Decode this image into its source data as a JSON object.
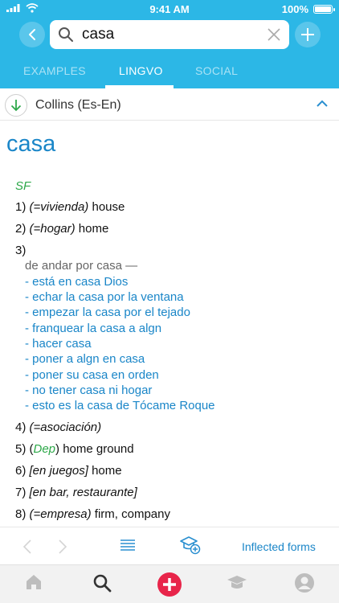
{
  "status": {
    "time": "9:41 AM",
    "battery": "100%"
  },
  "search": {
    "value": "casa"
  },
  "tabs": [
    {
      "label": "EXAMPLES",
      "active": false
    },
    {
      "label": "LINGVO",
      "active": true
    },
    {
      "label": "SOCIAL",
      "active": false
    }
  ],
  "dictionary": {
    "name": "Collins (Es-En)"
  },
  "entry": {
    "headword": "casa",
    "pos": "SF",
    "senses": {
      "s1": {
        "num": "1)",
        "note": "(=vivienda)",
        "text": " house"
      },
      "s2": {
        "num": "2)",
        "note": "(=hogar)",
        "text": " home"
      },
      "s3": {
        "num": "3)"
      },
      "s4": {
        "num": "4)",
        "note": "(=asociación)"
      },
      "s5": {
        "num": "5) (",
        "label": "Dep",
        "text": ") home ground"
      },
      "s6": {
        "num": "6)",
        "note": "[en juegos]",
        "text": " home"
      },
      "s7": {
        "num": "7)",
        "note": "[en bar, restaurante]"
      },
      "s8": {
        "num": "8)",
        "note": "(=empresa)",
        "text": " firm, company"
      }
    },
    "sub_heading": "de andar por casa —",
    "phrases": [
      "- está en casa Dios",
      "- echar la casa por la ventana",
      "- empezar la casa por el tejado",
      "- franquear la casa a algn",
      "- hacer casa",
      "- poner a algn en casa",
      "- poner su casa en orden",
      "- no tener casa ni hogar",
      "- esto es la casa de Tócame Roque"
    ]
  },
  "toolbar": {
    "inflected_label": "Inflected forms"
  },
  "colors": {
    "header": "#2cb7e6",
    "link": "#1a86c8",
    "green": "#2ea84a",
    "add": "#e8254a"
  }
}
